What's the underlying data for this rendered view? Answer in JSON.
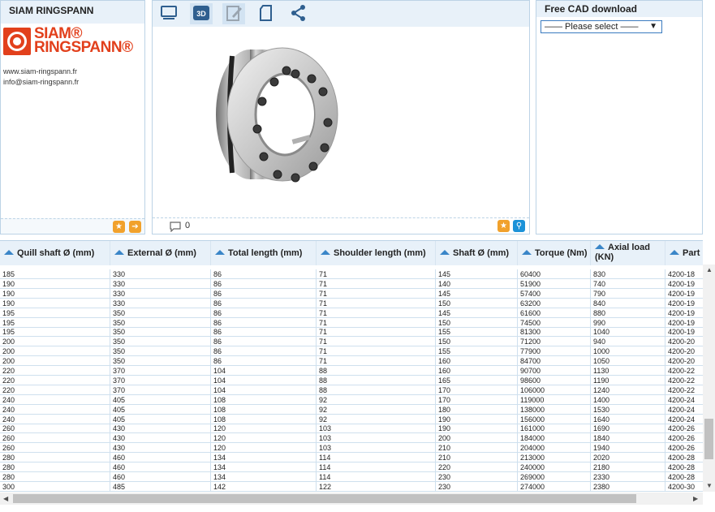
{
  "left_panel": {
    "title": "SIAM RINGSPANN",
    "logo_line1": "SIAM®",
    "logo_line2": "RINGSPANN®",
    "website": "www.siam-ringspann.fr",
    "email": "info@siam-ringspann.fr"
  },
  "center_panel": {
    "tools": [
      "monitor-icon",
      "3d-icon",
      "edit-icon",
      "document-icon",
      "share-icon"
    ],
    "tool_3d_label": "3D",
    "comment_count": "0"
  },
  "right_panel": {
    "title": "Free CAD download",
    "select_value": "—— Please select ——"
  },
  "colors": {
    "accent": "#3a86c8",
    "header_bg": "#e8f1f9",
    "brand": "#e2401c",
    "orange": "#f1a12c"
  },
  "table": {
    "columns": [
      {
        "label": "Quill shaft Ø (mm)"
      },
      {
        "label": "External Ø (mm)"
      },
      {
        "label": "Total length (mm)"
      },
      {
        "label": "Shoulder length (mm)"
      },
      {
        "label": "Shaft Ø (mm)"
      },
      {
        "label": "Torque (Nm)"
      },
      {
        "label": "Axial load",
        "label2": "(KN)"
      },
      {
        "label": "Part"
      }
    ],
    "rows": [
      [
        "185",
        "330",
        "86",
        "71",
        "145",
        "60400",
        "830",
        "4200-18"
      ],
      [
        "190",
        "330",
        "86",
        "71",
        "140",
        "51900",
        "740",
        "4200-19"
      ],
      [
        "190",
        "330",
        "86",
        "71",
        "145",
        "57400",
        "790",
        "4200-19"
      ],
      [
        "190",
        "330",
        "86",
        "71",
        "150",
        "63200",
        "840",
        "4200-19"
      ],
      [
        "195",
        "350",
        "86",
        "71",
        "145",
        "61600",
        "880",
        "4200-19"
      ],
      [
        "195",
        "350",
        "86",
        "71",
        "150",
        "74500",
        "990",
        "4200-19"
      ],
      [
        "195",
        "350",
        "86",
        "71",
        "155",
        "81300",
        "1040",
        "4200-19"
      ],
      [
        "200",
        "350",
        "86",
        "71",
        "150",
        "71200",
        "940",
        "4200-20"
      ],
      [
        "200",
        "350",
        "86",
        "71",
        "155",
        "77900",
        "1000",
        "4200-20"
      ],
      [
        "200",
        "350",
        "86",
        "71",
        "160",
        "84700",
        "1050",
        "4200-20"
      ],
      [
        "220",
        "370",
        "104",
        "88",
        "160",
        "90700",
        "1130",
        "4200-22"
      ],
      [
        "220",
        "370",
        "104",
        "88",
        "165",
        "98600",
        "1190",
        "4200-22"
      ],
      [
        "220",
        "370",
        "104",
        "88",
        "170",
        "106000",
        "1240",
        "4200-22"
      ],
      [
        "240",
        "405",
        "108",
        "92",
        "170",
        "119000",
        "1400",
        "4200-24"
      ],
      [
        "240",
        "405",
        "108",
        "92",
        "180",
        "138000",
        "1530",
        "4200-24"
      ],
      [
        "240",
        "405",
        "108",
        "92",
        "190",
        "156000",
        "1640",
        "4200-24"
      ],
      [
        "260",
        "430",
        "120",
        "103",
        "190",
        "161000",
        "1690",
        "4200-26"
      ],
      [
        "260",
        "430",
        "120",
        "103",
        "200",
        "184000",
        "1840",
        "4200-26"
      ],
      [
        "260",
        "430",
        "120",
        "103",
        "210",
        "204000",
        "1940",
        "4200-26"
      ],
      [
        "280",
        "460",
        "134",
        "114",
        "210",
        "213000",
        "2020",
        "4200-28"
      ],
      [
        "280",
        "460",
        "134",
        "114",
        "220",
        "240000",
        "2180",
        "4200-28"
      ],
      [
        "280",
        "460",
        "134",
        "114",
        "230",
        "269000",
        "2330",
        "4200-28"
      ],
      [
        "300",
        "485",
        "142",
        "122",
        "230",
        "274000",
        "2380",
        "4200-30"
      ]
    ]
  }
}
